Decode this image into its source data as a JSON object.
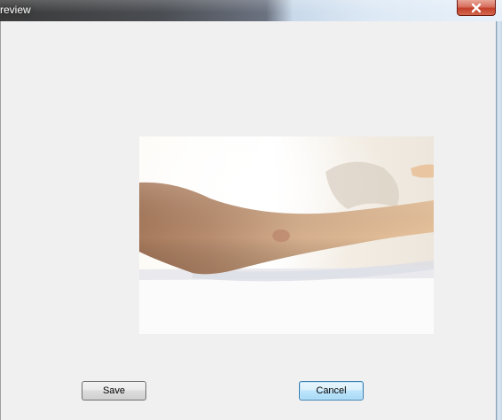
{
  "window": {
    "title": "review"
  },
  "preview": {
    "subject": "photo of a forearm resting on a white surface"
  },
  "buttons": {
    "save_label": "Save",
    "cancel_label": "Cancel"
  },
  "icons": {
    "close": "close-icon"
  },
  "colors": {
    "close_button": "#c8442f",
    "cancel_border": "#3c7fb1",
    "dialog_background": "#f0f0f0"
  }
}
